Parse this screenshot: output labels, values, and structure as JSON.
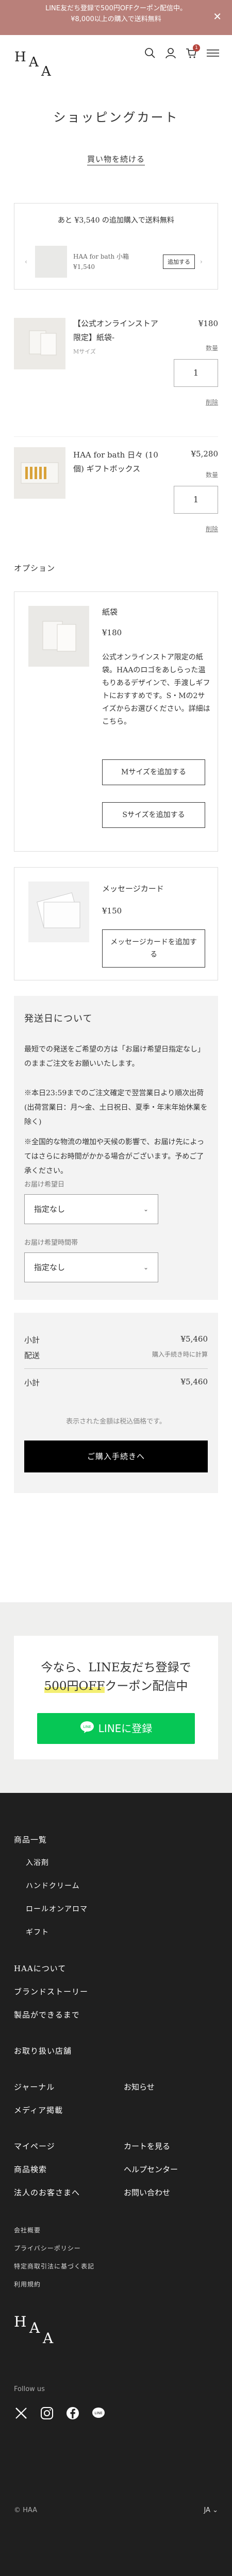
{
  "announcement": {
    "line1": "LINE友だち登録で500円OFFクーポン配信中。",
    "line2": "¥8,000以上の購入で送料無料"
  },
  "header": {
    "logo": [
      "H",
      "A",
      "A"
    ],
    "cart_count": "1"
  },
  "page_title": "ショッピングカート",
  "continue_label": "買い物を続ける",
  "shipping": {
    "message": "あと ¥3,540 の追加購入で送料無料",
    "upsell_name": "HAA for bath 小箱",
    "upsell_price": "¥1,540",
    "upsell_button": "追加する"
  },
  "cart_items": [
    {
      "name": "【公式オンラインストア限定】紙袋-",
      "variant": "Mサイズ",
      "price": "¥180",
      "qty_label": "数量",
      "qty": "1",
      "remove": "削除"
    },
    {
      "name": "HAA for bath 日々 (10個) ギフトボックス",
      "variant": "",
      "price": "¥5,280",
      "qty_label": "数量",
      "qty": "1",
      "remove": "削除"
    }
  ],
  "options": {
    "title": "オプション",
    "bag": {
      "name": "紙袋",
      "price": "¥180",
      "description": "公式オンラインストア限定の紙袋。HAAのロゴをあしらった温もりあるデザインで、手渡しギフトにおすすめです。S・Mの2サイズからお選びください。詳細はこちら。",
      "btn_m": "Mサイズを追加する",
      "btn_s": "Sサイズを追加する"
    },
    "card": {
      "name": "メッセージカード",
      "price": "¥150",
      "btn": "メッセージカードを追加する"
    }
  },
  "delivery": {
    "title": "発送日について",
    "text1": "最短での発送をご希望の方は「お届け希望日指定なし」のままご注文をお願いいたします。",
    "text2": "※本日23:59までのご注文確定で翌営業日より順次出荷(出荷営業日：月〜金、土日祝日、夏季・年末年始休業を除く)",
    "text3": "※全国的な物流の増加や天候の影響で、お届け先によってはさらにお時間がかかる場合がございます。予めご了承ください。",
    "date_label": "お届け希望日",
    "date_value": "指定なし",
    "time_label": "お届け希望時間帯",
    "time_value": "指定なし"
  },
  "summary": {
    "subtotal_label": "小計",
    "subtotal": "¥5,460",
    "shipping_label": "配送",
    "shipping_value": "購入手続き時に計算",
    "total_label": "小計",
    "total": "¥5,460",
    "tax_note": "表示された金額は税込価格です。",
    "checkout": "ご購入手続きへ"
  },
  "line_banner": {
    "text1": "今なら、LINE友だち登録で",
    "text2_highlight": "500円OFF",
    "text2_rest": "クーポン配信中",
    "button": "LINEに登録"
  },
  "footer": {
    "products": "商品一覧",
    "sub": [
      "入浴剤",
      "ハンドクリーム",
      "ロールオンアロマ",
      "ギフト"
    ],
    "about": "HAAについて",
    "brand_story": "ブランドストーリー",
    "making": "製品ができるまで",
    "stores": "お取り扱い店舗",
    "journal": "ジャーナル",
    "news": "お知らせ",
    "media": "メディア掲載",
    "mypage": "マイページ",
    "cart": "カートを見る",
    "search": "商品検索",
    "help": "ヘルプセンター",
    "corporate": "法人のお客さまへ",
    "contact": "お問い合わせ",
    "company": "会社概要",
    "privacy": "プライバシーポリシー",
    "law": "特定商取引法に基づく表記",
    "terms": "利用規約",
    "logo": [
      "H",
      "A",
      "A"
    ],
    "follow": "Follow us",
    "copyright": "© HAA",
    "lang": "JA"
  }
}
